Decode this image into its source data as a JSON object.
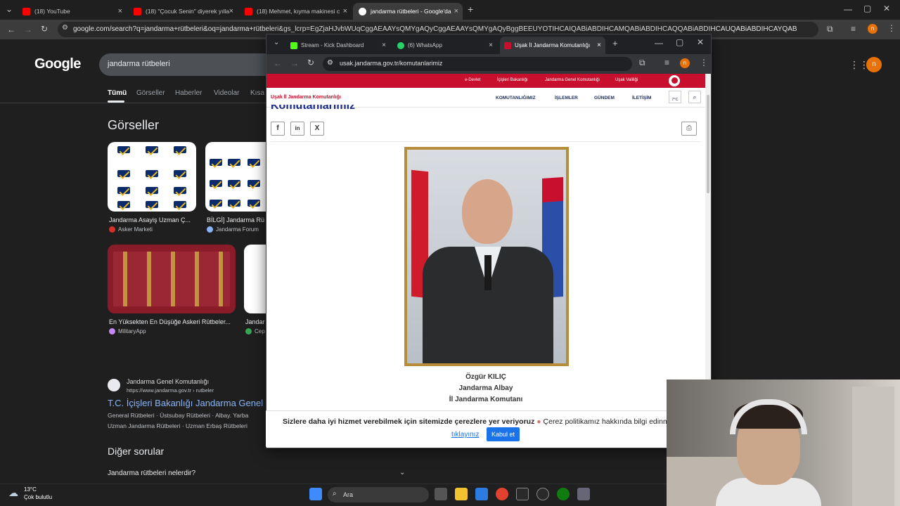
{
  "outer_tabs": [
    {
      "label": "(18) YouTube",
      "color": "#ff0000"
    },
    {
      "label": "(18) \"Çocuk Senin\" diyerek yılla",
      "color": "#ff0000"
    },
    {
      "label": "(18) Mehmet, kıyma makinesi c",
      "color": "#ff0000"
    },
    {
      "label": "jandarma rütbeleri - Google'da",
      "color": "#ffffff"
    }
  ],
  "outer_url": "google.com/search?q=jandarma+rütbeleri&oq=jandarma+rütbeleri&gs_lcrp=EgZjaHJvbWUqCggAEAAYsQMYgAQyCggAEAAYsQMYgAQyBggBEEUYOTIHCAIQABiABDIHCAMQABiABDIHCAQQABiABDIHCAUQABiABDIHCAYQABiABDIHCAcQABiABDIHC...",
  "google": {
    "logo": "Google",
    "query": "jandarma rütbeleri",
    "tabs": [
      "Tümü",
      "Görseller",
      "Haberler",
      "Videolar",
      "Kısa"
    ],
    "images_heading": "Görseller",
    "image_results": [
      {
        "caption": "Jandarma Asayiş Uzman Ç...",
        "source": "Asker Marketi"
      },
      {
        "caption": "BİLGİ] Jandarma Rü",
        "source": "Jandarma Forum"
      },
      {
        "caption": "En Yüksekten En Düşüğe Askeri Rütbeler...",
        "source": "MilitaryApp"
      },
      {
        "caption": "Jandar",
        "source": "Cep"
      }
    ],
    "result": {
      "site": "Jandarma Genel Komutanlığı",
      "url": "https://www.jandarma.gov.tr › rutbeler",
      "title": "T.C. İçişleri Bakanlığı Jandarma Genel",
      "snippet1": "General Rütbeleri · Üstsubay Rütbeleri · Albay. Yarba",
      "snippet2": "Uzman Jandarma Rütbeleri · Uzman Erbaş Rütbeleri"
    },
    "other_questions": "Diğer sorular",
    "question1": "Jandarma rütbeleri nelerdir?",
    "avatar_letter": "n"
  },
  "window": {
    "tabs": [
      {
        "label": "Stream - Kick Dashboard",
        "color": "#53fc18"
      },
      {
        "label": "(6) WhatsApp",
        "color": "#25d366"
      },
      {
        "label": "Uşak İl Jandarma Komutanlığı",
        "color": "#c8102e"
      }
    ],
    "url": "usak.jandarma.gov.tr/komutanlarimiz",
    "avatar_letter": "n"
  },
  "site": {
    "top_links": [
      "e-Devlet",
      "İçişleri Bakanlığı",
      "Jandarma Genel Komutanlığı",
      "Uşak Valiliği"
    ],
    "name": "Uşak İl Jandarma Komutanlığı",
    "nav": [
      "KOMUTANLIĞIMIZ",
      "İŞLEMLER",
      "GÜNDEM",
      "İLETİŞİM"
    ],
    "weather": "7°C",
    "heading": "Komutanlarımız",
    "commander": {
      "name": "Özgür KILIÇ",
      "rank": "Jandarma Albay",
      "role": "İl Jandarma Komutanı"
    }
  },
  "cookie": {
    "text_bold": "Sizlere daha iyi hizmet verebilmek için sitemizde çerezlere yer veriyoruz",
    "text_rest": " Çerez politikamız hakkında bilgi edinm",
    "link": "tıklayınız",
    "accept": "Kabul et"
  },
  "taskbar": {
    "temp": "13°C",
    "condition": "Çok bulutlu",
    "search": "Ara"
  }
}
